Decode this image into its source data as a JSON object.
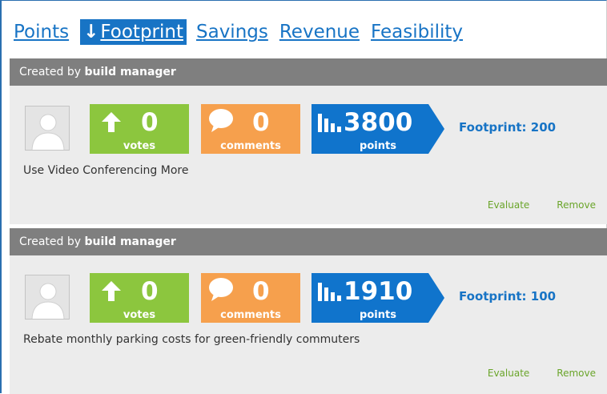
{
  "sort_tabs": [
    {
      "label": "Points",
      "active": false
    },
    {
      "label": "Footprint",
      "active": true
    },
    {
      "label": "Savings",
      "active": false
    },
    {
      "label": "Revenue",
      "active": false
    },
    {
      "label": "Feasibility",
      "active": false
    }
  ],
  "active_sort_arrow": "↓",
  "ideas": [
    {
      "created_by_prefix": "Created by",
      "author": "build manager",
      "votes": "0",
      "votes_label": "votes",
      "comments": "0",
      "comments_label": "comments",
      "points": "3800",
      "points_label": "points",
      "metric": "Footprint: 200",
      "title": "Use Video Conferencing More",
      "evaluate_label": "Evaluate",
      "remove_label": "Remove"
    },
    {
      "created_by_prefix": "Created by",
      "author": "build manager",
      "votes": "0",
      "votes_label": "votes",
      "comments": "0",
      "comments_label": "comments",
      "points": "1910",
      "points_label": "points",
      "metric": "Footprint: 100",
      "title": "Rebate monthly parking costs for green-friendly commuters",
      "evaluate_label": "Evaluate",
      "remove_label": "Remove"
    }
  ],
  "colors": {
    "link": "#1874c5",
    "votes": "#8cc63e",
    "comments": "#f6a04d",
    "points": "#1074cc",
    "header": "#7f7f7f",
    "action": "#6aa52a"
  },
  "icons": {
    "avatar": "user-silhouette-icon",
    "votes": "arrow-up-icon",
    "comments": "speech-bubble-icon",
    "points": "bar-chart-icon"
  }
}
